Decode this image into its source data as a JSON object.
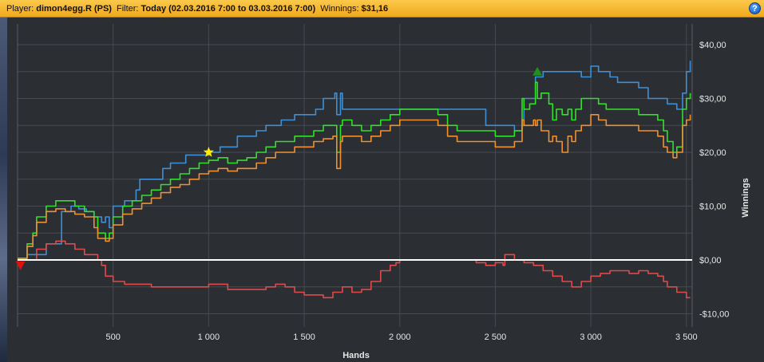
{
  "header": {
    "player_label": "Player:",
    "player_value": "dimon4egg.R (PS)",
    "filter_label": "Filter:",
    "filter_value": "Today (02.03.2016 7:00 to 03.03.2016 7:00)",
    "winnings_label": "Winnings:",
    "winnings_value": "$31,16",
    "help_label": "?"
  },
  "colors": {
    "background": "#2b2e33",
    "grid": "#474b51",
    "zero_line": "#ffffff",
    "blue": "#3f8fd6",
    "green": "#33e02c",
    "orange": "#f0902f",
    "red": "#e04a4a",
    "star": "#ffee00",
    "marker_up": "#1f8f1f",
    "marker_down": "#e01010"
  },
  "chart_data": {
    "type": "line",
    "xlabel": "Hands",
    "ylabel": "Winnings",
    "xlim": [
      0,
      3530
    ],
    "ylim": [
      -12,
      42
    ],
    "x_ticks": [
      500,
      1000,
      1500,
      2000,
      2500,
      3000,
      3500
    ],
    "x_tick_labels": [
      "500",
      "1 000",
      "1 500",
      "2 000",
      "2 500",
      "3 000",
      "3 500"
    ],
    "y_ticks": [
      40,
      30,
      20,
      10,
      0,
      -10
    ],
    "y_tick_labels": [
      "$40,00",
      "$30,00",
      "$20,00",
      "$10,00",
      "$0,00",
      "-$10,00"
    ],
    "grid": true,
    "series": [
      {
        "color": "blue",
        "x": [
          0,
          50,
          80,
          150,
          190,
          230,
          280,
          320,
          360,
          400,
          440,
          460,
          480,
          500,
          560,
          620,
          640,
          680,
          720,
          760,
          800,
          880,
          950,
          1000,
          1060,
          1100,
          1150,
          1200,
          1250,
          1300,
          1380,
          1450,
          1500,
          1560,
          1600,
          1660,
          1670,
          1690,
          1700,
          1750,
          1850,
          1950,
          2000,
          2100,
          2200,
          2300,
          2400,
          2450,
          2500,
          2550,
          2600,
          2640,
          2650,
          2680,
          2700,
          2710,
          2750,
          2800,
          2840,
          2880,
          2920,
          2950,
          3000,
          3040,
          3080,
          3100,
          3140,
          3200,
          3250,
          3300,
          3340,
          3360,
          3380,
          3400,
          3430,
          3450,
          3480,
          3500,
          3520
        ],
        "y": [
          0.3,
          1,
          1,
          3,
          3,
          9,
          10,
          9.5,
          9,
          8,
          7,
          8,
          6,
          10,
          11,
          13,
          15,
          15,
          15,
          17,
          18,
          19.5,
          19.5,
          20,
          21,
          21,
          23,
          23,
          24,
          25,
          26,
          27,
          27,
          28,
          30,
          31,
          27,
          31,
          28,
          28,
          28,
          28,
          28,
          28,
          28,
          28,
          28,
          25,
          25,
          25,
          24,
          25,
          30,
          30,
          30,
          34,
          35,
          35,
          35,
          35,
          35,
          34,
          36,
          35,
          35,
          34,
          33,
          33,
          32,
          30,
          30,
          30,
          30,
          29,
          29,
          28,
          31,
          35,
          37
        ]
      },
      {
        "color": "green",
        "x": [
          0,
          50,
          80,
          100,
          150,
          200,
          250,
          300,
          350,
          400,
          420,
          460,
          480,
          500,
          550,
          600,
          650,
          700,
          750,
          800,
          850,
          900,
          950,
          1000,
          1050,
          1100,
          1150,
          1200,
          1250,
          1300,
          1350,
          1400,
          1450,
          1500,
          1550,
          1600,
          1650,
          1670,
          1690,
          1700,
          1750,
          1800,
          1850,
          1900,
          1950,
          2000,
          2050,
          2100,
          2150,
          2200,
          2250,
          2300,
          2350,
          2400,
          2450,
          2500,
          2550,
          2600,
          2640,
          2650,
          2680,
          2700,
          2710,
          2720,
          2740,
          2780,
          2800,
          2820,
          2850,
          2880,
          2900,
          2920,
          2950,
          3000,
          3040,
          3080,
          3100,
          3150,
          3200,
          3250,
          3300,
          3350,
          3380,
          3400,
          3430,
          3450,
          3480,
          3500,
          3520
        ],
        "y": [
          0.3,
          3,
          5,
          8,
          10,
          11,
          11,
          10,
          9,
          8,
          5,
          4,
          5,
          8,
          10,
          11,
          12,
          13,
          14,
          15,
          16,
          17,
          18,
          18.5,
          19,
          18,
          18.5,
          19,
          20,
          21,
          22,
          22,
          23,
          23,
          24,
          25,
          25,
          20,
          25,
          26,
          25,
          24,
          25,
          26,
          27,
          28,
          28,
          28,
          28,
          27,
          25,
          24,
          24,
          24,
          24,
          23,
          23,
          24,
          30,
          28,
          29,
          29,
          33,
          30,
          31,
          29,
          26,
          28,
          27,
          28,
          26,
          28,
          30,
          30,
          29,
          28,
          28,
          28,
          28,
          27,
          27,
          26,
          24,
          22,
          20,
          21,
          28,
          30,
          31
        ]
      },
      {
        "color": "orange",
        "x": [
          0,
          50,
          80,
          100,
          150,
          200,
          250,
          300,
          350,
          400,
          420,
          460,
          480,
          500,
          550,
          600,
          650,
          700,
          750,
          800,
          850,
          900,
          950,
          1000,
          1050,
          1100,
          1150,
          1200,
          1250,
          1300,
          1350,
          1400,
          1450,
          1500,
          1550,
          1600,
          1650,
          1670,
          1690,
          1700,
          1750,
          1800,
          1850,
          1900,
          1950,
          2000,
          2050,
          2100,
          2150,
          2200,
          2250,
          2300,
          2350,
          2400,
          2450,
          2500,
          2550,
          2600,
          2640,
          2650,
          2680,
          2700,
          2710,
          2720,
          2740,
          2780,
          2800,
          2820,
          2850,
          2880,
          2900,
          2920,
          2950,
          3000,
          3040,
          3080,
          3100,
          3150,
          3200,
          3250,
          3300,
          3350,
          3380,
          3400,
          3430,
          3450,
          3480,
          3500,
          3520
        ],
        "y": [
          0.3,
          2.5,
          4.5,
          7,
          9,
          9.5,
          9,
          8.5,
          8,
          6,
          4,
          3.5,
          4,
          6.5,
          8.5,
          9.5,
          10.5,
          11.5,
          12.5,
          13.5,
          14,
          15,
          16,
          16.5,
          17,
          16.5,
          17,
          17,
          18,
          19,
          20,
          20,
          21,
          21,
          22,
          22.5,
          23,
          17,
          22,
          23,
          23,
          22,
          23,
          24,
          25,
          26,
          26,
          26,
          26,
          25,
          23,
          22,
          22,
          22,
          22,
          21,
          21,
          22,
          26,
          25,
          25,
          26,
          25,
          26,
          24,
          22,
          23,
          22,
          20,
          23,
          22,
          24,
          25,
          27,
          26,
          25,
          25,
          25,
          25,
          24,
          24,
          23,
          21,
          20,
          19,
          20,
          25,
          26,
          27
        ]
      },
      {
        "color": "red",
        "x": [
          0,
          50,
          100,
          150,
          200,
          250,
          300,
          350,
          400,
          420,
          440,
          460,
          500,
          560,
          600,
          700,
          800,
          900,
          1000,
          1100,
          1200,
          1300,
          1350,
          1400,
          1450,
          1500,
          1560,
          1600,
          1650,
          1700,
          1750,
          1800,
          1850,
          1900,
          1950,
          1980,
          2000,
          2050,
          2100,
          2150,
          2200,
          2300,
          2400,
          2450,
          2500,
          2540,
          2550,
          2600,
          2650,
          2700,
          2750,
          2800,
          2850,
          2900,
          2950,
          3000,
          3050,
          3100,
          3150,
          3200,
          3250,
          3300,
          3350,
          3380,
          3400,
          3450,
          3500,
          3520
        ],
        "y": [
          0,
          0,
          2,
          3,
          3.5,
          3,
          2,
          1,
          1,
          0,
          -1,
          -3,
          -4,
          -4.5,
          -4.5,
          -5,
          -5,
          -5,
          -4.5,
          -5.5,
          -5.5,
          -5,
          -4.5,
          -5,
          -6,
          -6.5,
          -6.5,
          -7,
          -6,
          -5,
          -6,
          -5.5,
          -4,
          -2,
          -1,
          -0.5,
          0,
          0,
          0,
          0,
          0,
          0,
          -0.5,
          -1,
          -0.5,
          -1,
          1,
          0,
          -0.5,
          -1,
          -2,
          -3,
          -4,
          -5,
          -4,
          -3,
          -2.5,
          -2,
          -2,
          -2.5,
          -2,
          -2.5,
          -3,
          -4,
          -5,
          -6,
          -7,
          -7
        ]
      }
    ],
    "markers": [
      {
        "shape": "star",
        "x": 1000,
        "y": 20,
        "color": "star"
      },
      {
        "shape": "triangle-up",
        "x": 2720,
        "y": 35,
        "color": "marker_up"
      },
      {
        "shape": "triangle-down",
        "x": 15,
        "y": -1,
        "color": "marker_down"
      }
    ]
  }
}
